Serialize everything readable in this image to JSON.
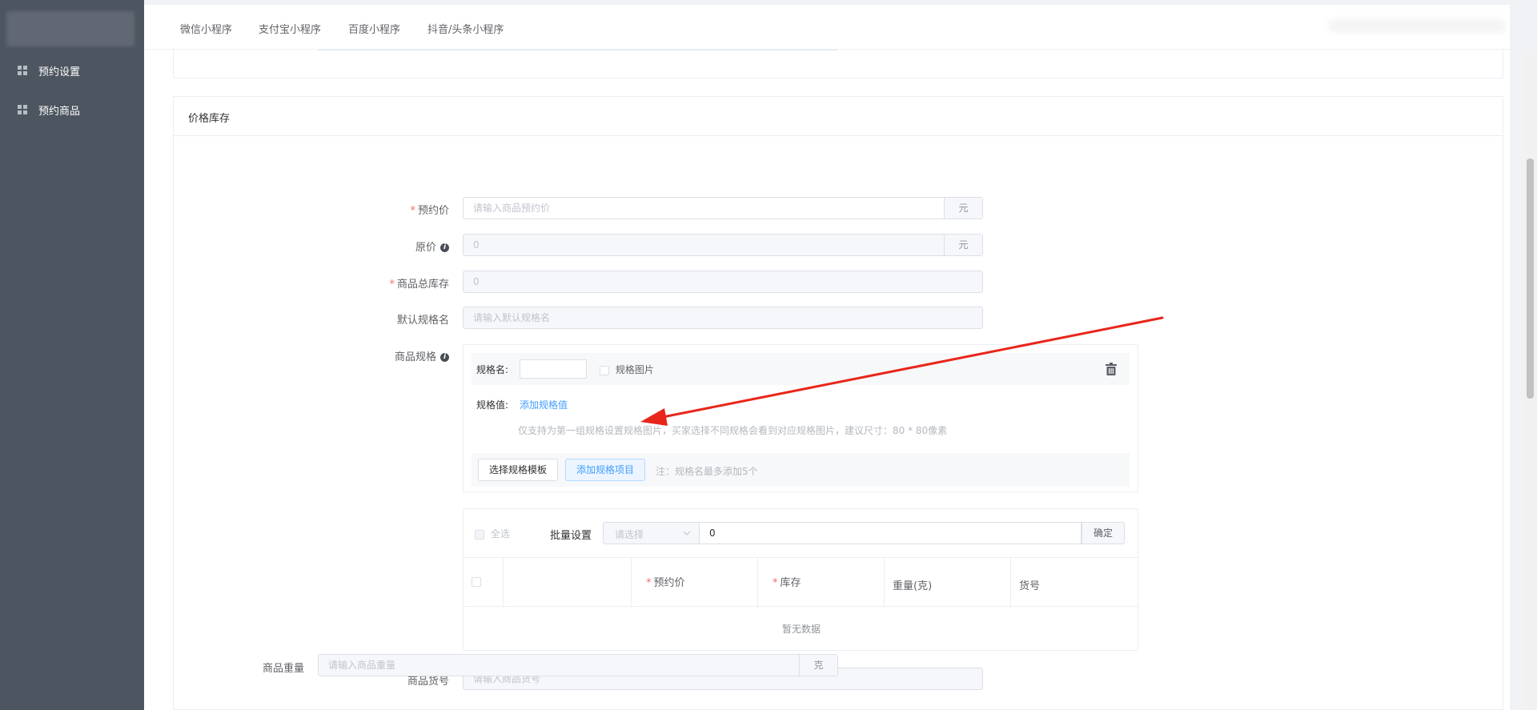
{
  "sidebar": {
    "items": [
      {
        "label": "预约设置",
        "icon": "grid-icon"
      },
      {
        "label": "预约商品",
        "icon": "grid-icon"
      }
    ]
  },
  "topbar": {
    "tabs": [
      "微信小程序",
      "支付宝小程序",
      "百度小程序",
      "抖音/头条小程序"
    ]
  },
  "section": {
    "title": "价格库存"
  },
  "form": {
    "reserve_price": {
      "label": "预约价",
      "placeholder": "请输入商品预约价",
      "unit": "元"
    },
    "original_price": {
      "label": "原价",
      "value": "0",
      "unit": "元"
    },
    "total_stock": {
      "label": "商品总库存",
      "value": "0"
    },
    "default_spec_name": {
      "label": "默认规格名",
      "placeholder": "请输入默认规格名"
    },
    "spec": {
      "label": "商品规格",
      "spec_name_label": "规格名:",
      "spec_image_label": "规格图片",
      "spec_value_label": "规格值:",
      "add_value_link": "添加规格值",
      "tip": "仅支持为第一组规格设置规格图片，买家选择不同规格会看到对应规格图片，建议尺寸：80 * 80像素",
      "select_template_button": "选择规格模板",
      "add_item_button": "添加规格项目",
      "note": "注：规格名最多添加5个"
    },
    "batch": {
      "select_all": "全选",
      "batch_label": "批量设置",
      "select_placeholder": "请选择",
      "value": "0",
      "confirm": "确定",
      "columns": [
        "预约价",
        "库存",
        "重量(克)",
        "货号"
      ],
      "empty": "暂无数据"
    },
    "sku": {
      "label": "商品货号",
      "placeholder": "请输入商品货号"
    },
    "weight": {
      "label": "商品重量",
      "placeholder": "请输入商品重量",
      "unit": "克"
    }
  },
  "colors": {
    "sidebar_bg": "#4d5560",
    "primary": "#409eff",
    "required": "#f56c6c",
    "arrow": "#e8261b"
  }
}
